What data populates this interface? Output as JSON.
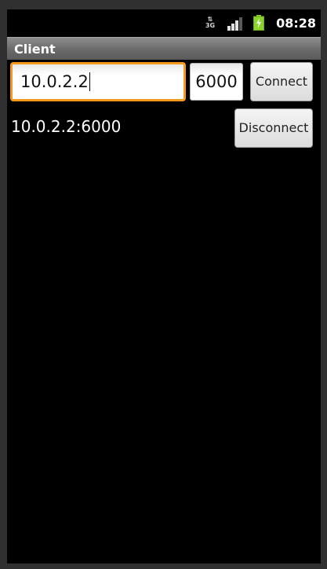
{
  "status_bar": {
    "network_type": "3G",
    "time": "08:28",
    "icons": [
      "network-3g-icon",
      "signal-strength-icon",
      "battery-charging-icon"
    ]
  },
  "app": {
    "title": "Client"
  },
  "form": {
    "host_value": "10.0.2.2",
    "port_value": "6000",
    "connect_label": "Connect",
    "disconnect_label": "Disconnect"
  },
  "connection": {
    "current": "10.0.2.2:6000"
  },
  "colors": {
    "focus_border": "#f59a1d",
    "battery": "#8bd42b"
  }
}
